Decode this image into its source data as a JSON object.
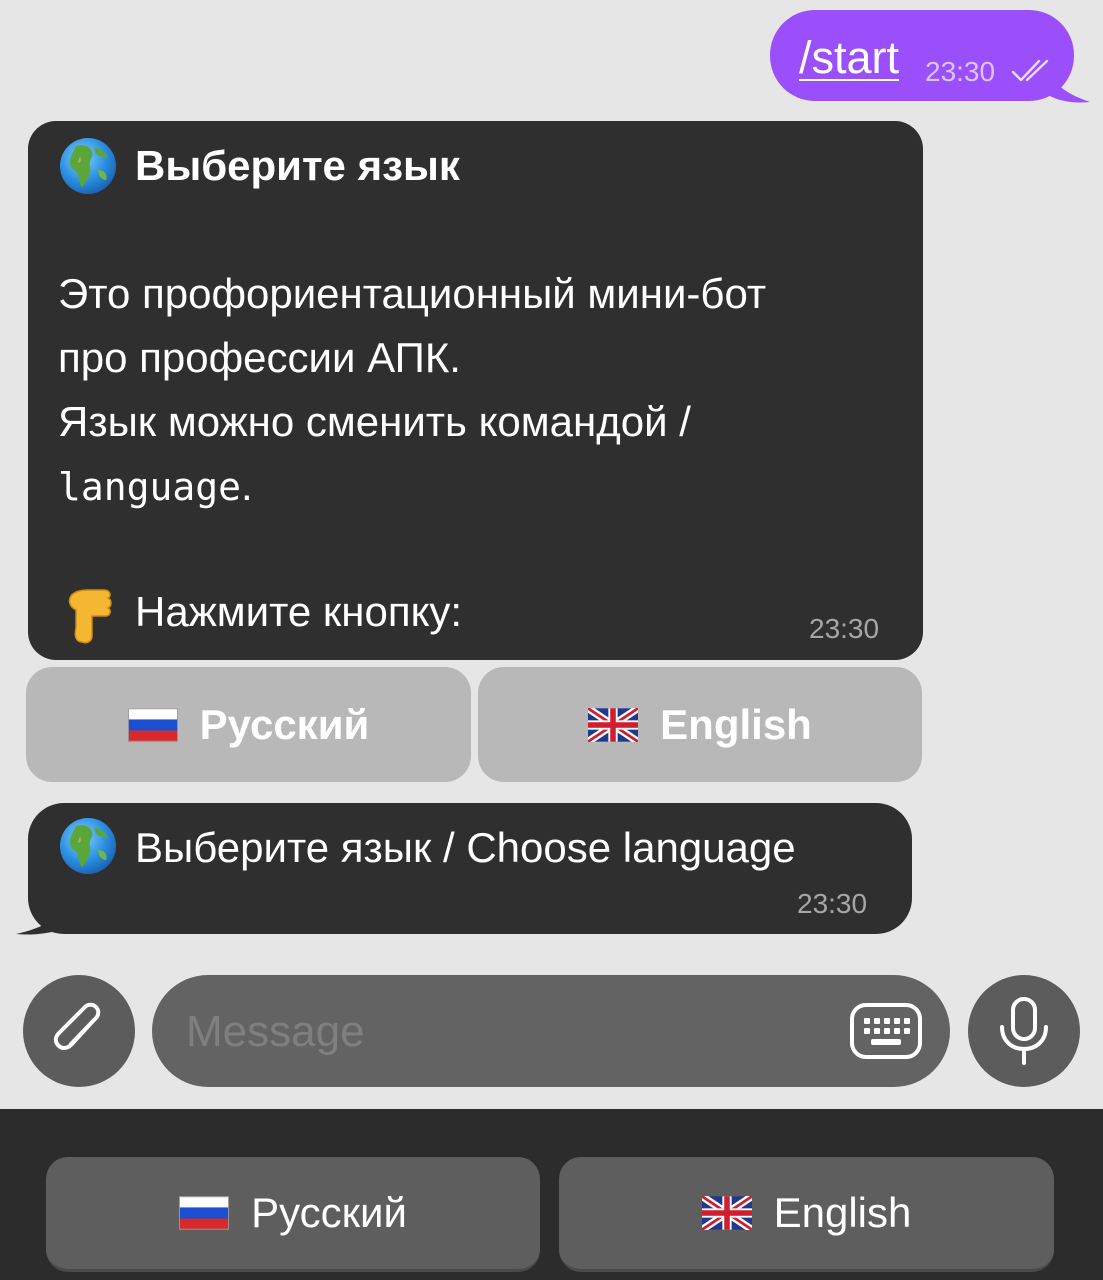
{
  "outgoing": {
    "text": "/start",
    "time": "23:30",
    "status_icon": "double-check-icon"
  },
  "message1": {
    "icon": "globe-icon",
    "title": "Выберите язык",
    "line1": "Это профориентационный мини-бот",
    "line2": "про профессии АПК.",
    "line3": "Язык можно сменить командой /",
    "line4_code": "language",
    "line4_tail": ".",
    "prompt_icon": "pointing-down-icon",
    "prompt": "Нажмите кнопку:",
    "time": "23:30"
  },
  "inline_keyboard": {
    "russian_label": "Русский",
    "russian_flag": "russia-flag-icon",
    "english_label": "English",
    "english_flag": "uk-flag-icon"
  },
  "message2": {
    "icon": "globe-icon",
    "text": "Выберите язык / Choose language",
    "time": "23:30"
  },
  "composer": {
    "placeholder": "Message",
    "attach_icon": "paperclip-icon",
    "keyboard_icon": "keyboard-icon",
    "mic_icon": "microphone-icon"
  },
  "reply_keyboard": {
    "russian_label": "Русский",
    "english_label": "English"
  },
  "colors": {
    "background": "#e6e6e6",
    "outgoing_bubble": "#9b4ffa",
    "incoming_bubble": "#2f2f2f",
    "inline_button": "#b8b8b8",
    "reply_panel": "#2c2c2c"
  }
}
